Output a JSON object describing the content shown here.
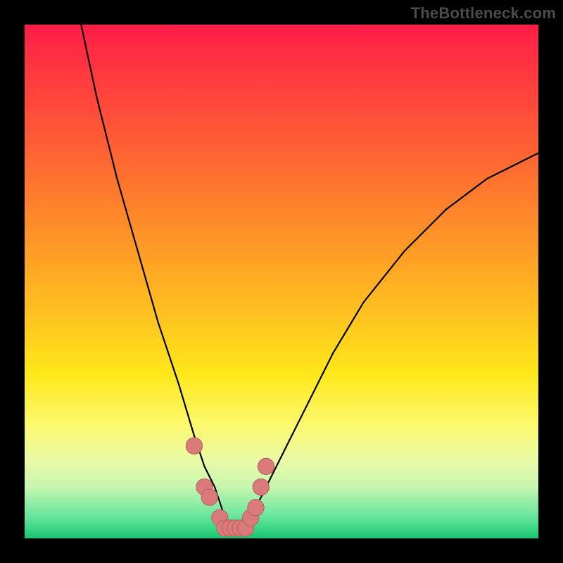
{
  "watermark": "TheBottleneck.com",
  "chart_data": {
    "type": "line",
    "title": "",
    "xlabel": "",
    "ylabel": "",
    "xlim": [
      0,
      100
    ],
    "ylim": [
      0,
      100
    ],
    "grid": false,
    "legend": false,
    "series": [
      {
        "name": "bottleneck-curve",
        "color": "#000000",
        "x": [
          11,
          14,
          18,
          22,
          26,
          30,
          33,
          35,
          37,
          38,
          39,
          40,
          41,
          42,
          43,
          44,
          46,
          50,
          55,
          60,
          66,
          74,
          82,
          90,
          100
        ],
        "values": [
          100,
          86,
          70,
          56,
          42,
          30,
          20,
          14,
          10,
          7,
          4,
          2,
          1,
          1,
          2,
          4,
          8,
          16,
          26,
          36,
          46,
          56,
          64,
          70,
          75
        ]
      }
    ],
    "markers": {
      "name": "highlight-dots",
      "color": "#db7a7a",
      "stroke": "#b85f5f",
      "x": [
        33,
        35,
        36,
        38,
        39,
        40,
        41,
        42,
        43,
        44,
        45,
        46,
        47
      ],
      "values": [
        18,
        10,
        8,
        4,
        2,
        2,
        2,
        2,
        2,
        4,
        6,
        10,
        14
      ],
      "radius_pct": 1.6
    }
  }
}
